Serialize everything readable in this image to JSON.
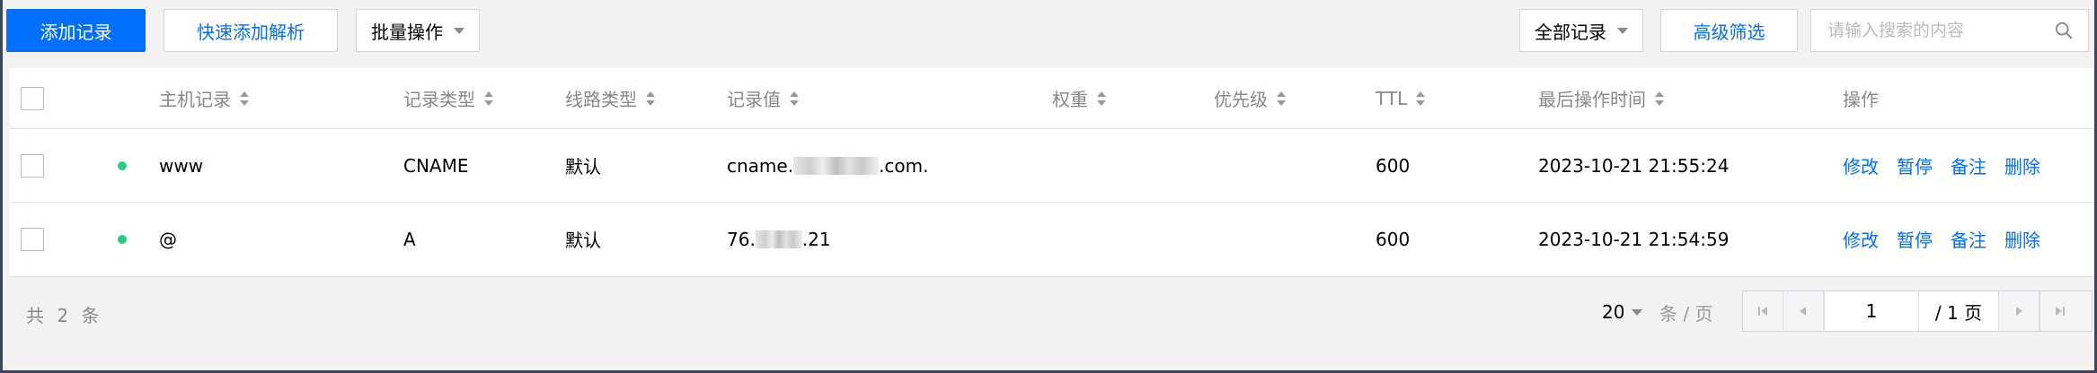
{
  "toolbar": {
    "add_record": "添加记录",
    "quick_add": "快速添加解析",
    "batch_ops": "批量操作",
    "filter_all": "全部记录",
    "advanced_filter": "高级筛选",
    "search_placeholder": "请输入搜索的内容"
  },
  "table": {
    "headers": {
      "host": "主机记录",
      "type": "记录类型",
      "line": "线路类型",
      "value": "记录值",
      "weight": "权重",
      "priority": "优先级",
      "ttl": "TTL",
      "last_time": "最后操作时间",
      "actions": "操作"
    },
    "rows": [
      {
        "status": "enabled",
        "host": "www",
        "type": "CNAME",
        "line": "默认",
        "value_prefix": "cname.",
        "value_suffix": ".com.",
        "weight": "",
        "priority": "",
        "ttl": "600",
        "last_time": "2023-10-21 21:55:24",
        "actions": [
          "修改",
          "暂停",
          "备注",
          "删除"
        ]
      },
      {
        "status": "enabled",
        "host": "@",
        "type": "A",
        "line": "默认",
        "value_prefix": "76.",
        "value_suffix": ".21",
        "weight": "",
        "priority": "",
        "ttl": "600",
        "last_time": "2023-10-21 21:54:59",
        "actions": [
          "修改",
          "暂停",
          "备注",
          "删除"
        ]
      }
    ]
  },
  "footer": {
    "total": "共 2 条",
    "page_size": "20",
    "per_page": "条 / 页",
    "current_page": "1",
    "total_pages": "/ 1 页"
  },
  "colors": {
    "primary": "#006eff",
    "status_dot": "#29cc85"
  }
}
